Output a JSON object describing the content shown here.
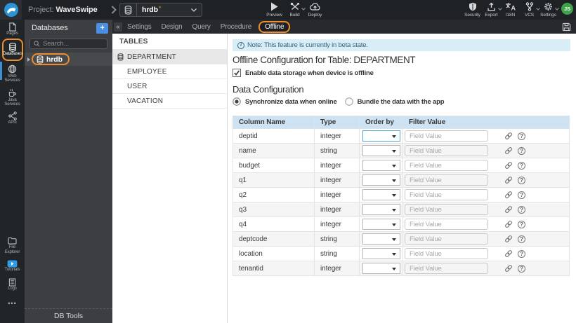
{
  "topbar": {
    "project_label": "Project:",
    "project_name": "WaveSwipe",
    "db_selector": {
      "value": "hrdb"
    },
    "actions": [
      {
        "label": "Preview"
      },
      {
        "label": "Build"
      },
      {
        "label": "Deploy"
      }
    ],
    "right_actions": [
      {
        "label": "Security"
      },
      {
        "label": "Export"
      },
      {
        "label": "I18N"
      },
      {
        "label": "VCS"
      },
      {
        "label": "Settings"
      }
    ],
    "avatar": "JS"
  },
  "sidebar": {
    "items": [
      {
        "label": "Pages"
      },
      {
        "label": "Databases",
        "active": true
      },
      {
        "label": "Web Services"
      },
      {
        "label": "Java Services"
      },
      {
        "label": "APIs"
      }
    ],
    "bottom_items": [
      {
        "label": "File Explorer"
      },
      {
        "label": "Tutorials"
      },
      {
        "label": "Logs"
      }
    ],
    "overflow": "•••"
  },
  "db_panel": {
    "title": "Databases",
    "add_button": "+",
    "search_placeholder": "Search...",
    "items": [
      {
        "label": "hrdb",
        "active": true
      }
    ],
    "footer": "DB Tools",
    "collapse_icon": "«"
  },
  "tabs": [
    {
      "label": "Settings"
    },
    {
      "label": "Design"
    },
    {
      "label": "Query"
    },
    {
      "label": "Procedure"
    },
    {
      "label": "Offline",
      "active": true
    }
  ],
  "tables_panel": {
    "title": "TABLES",
    "items": [
      {
        "label": "DEPARTMENT",
        "active": true
      },
      {
        "label": "EMPLOYEE"
      },
      {
        "label": "USER"
      },
      {
        "label": "VACATION"
      }
    ]
  },
  "main": {
    "note": "Note: This feature is currently in beta state.",
    "title": "Offline Configuration for Table: DEPARTMENT",
    "enable_checkbox_label": "Enable data storage when device is offline",
    "enable_checked": true,
    "section_title": "Data Configuration",
    "radio_options": [
      {
        "label": "Synchronize data when online",
        "selected": true
      },
      {
        "label": "Bundle the data with the app",
        "selected": false
      }
    ],
    "table": {
      "headers": [
        "Column Name",
        "Type",
        "Order by",
        "Filter Value"
      ],
      "filter_placeholder": "Field Value",
      "rows": [
        {
          "name": "deptid",
          "type": "integer"
        },
        {
          "name": "name",
          "type": "string"
        },
        {
          "name": "budget",
          "type": "integer"
        },
        {
          "name": "q1",
          "type": "integer"
        },
        {
          "name": "q2",
          "type": "integer"
        },
        {
          "name": "q3",
          "type": "integer"
        },
        {
          "name": "q4",
          "type": "integer"
        },
        {
          "name": "deptcode",
          "type": "string"
        },
        {
          "name": "location",
          "type": "string"
        },
        {
          "name": "tenantid",
          "type": "integer"
        }
      ]
    }
  },
  "colors": {
    "accent_orange": "#ee8e2d",
    "accent_blue": "#4a90e2",
    "note_bg": "#d9edf7",
    "header_bg": "#cde2f2"
  }
}
